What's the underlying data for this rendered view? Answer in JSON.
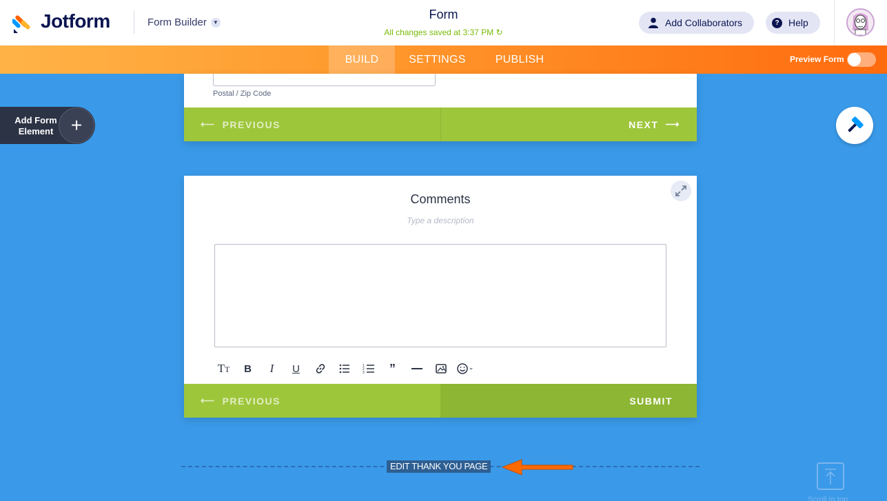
{
  "header": {
    "logo_text": "Jotform",
    "builder_label": "Form Builder",
    "form_title": "Form",
    "saved_status": "All changes saved at 3:37 PM",
    "add_collaborators_label": "Add Collaborators",
    "help_label": "Help"
  },
  "nav": {
    "tabs": [
      {
        "label": "BUILD",
        "active": true
      },
      {
        "label": "SETTINGS",
        "active": false
      },
      {
        "label": "PUBLISH",
        "active": false
      }
    ],
    "preview_label": "Preview Form",
    "preview_on": false
  },
  "sidebar": {
    "add_element_label": "Add Form Element"
  },
  "page1": {
    "postal_label": "Postal / Zip Code",
    "previous_label": "PREVIOUS",
    "next_label": "NEXT"
  },
  "page2": {
    "comments_title": "Comments",
    "description_placeholder": "Type a description",
    "previous_label": "PREVIOUS",
    "submit_label": "SUBMIT",
    "toolbar_icons": [
      "text-size-icon",
      "bold-icon",
      "italic-icon",
      "underline-icon",
      "link-icon",
      "bullet-list-icon",
      "numbered-list-icon",
      "quote-icon",
      "horizontal-rule-icon",
      "image-icon",
      "emoji-icon"
    ]
  },
  "footer": {
    "thank_you_label": "EDIT THANK YOU PAGE",
    "scroll_top_label": "Scroll to top"
  },
  "colors": {
    "accent_orange": "#ff6b0f",
    "nav_green": "#9ec63b",
    "canvas_blue": "#3a9ae9",
    "saved_green": "#78bb07"
  }
}
